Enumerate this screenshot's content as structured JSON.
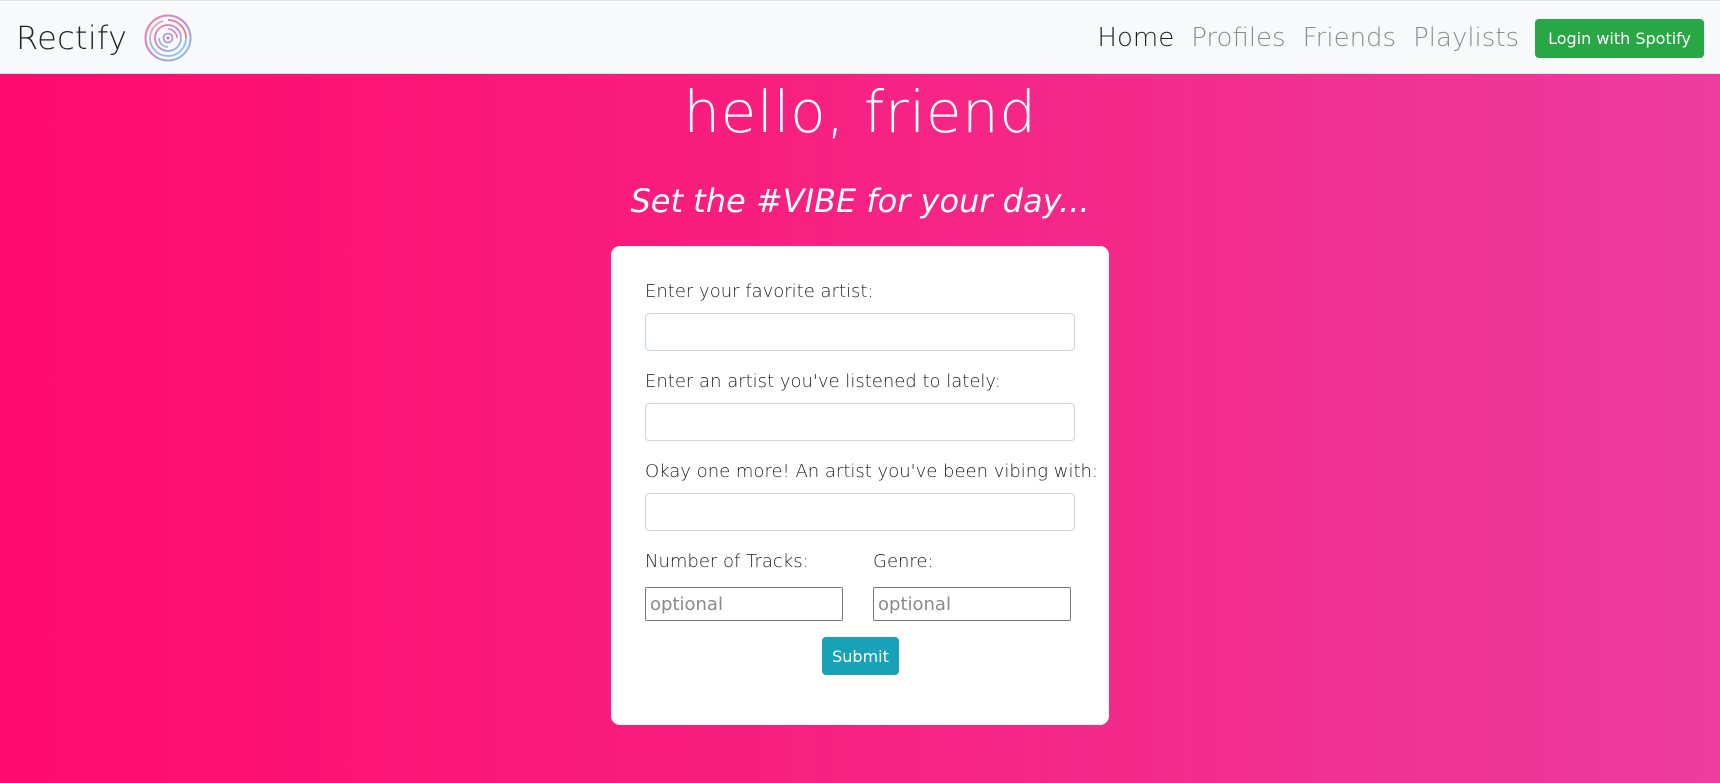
{
  "navbar": {
    "brand": "Rectify",
    "logo_icon": "vinyl-record-icon",
    "links": [
      {
        "label": "Home",
        "active": true
      },
      {
        "label": "Profiles",
        "active": false
      },
      {
        "label": "Friends",
        "active": false
      },
      {
        "label": "Playlists",
        "active": false
      }
    ],
    "login_label": "Login with Spotify"
  },
  "hero": {
    "title": "hello, friend",
    "subtitle": "Set the #VIBE for your day..."
  },
  "form": {
    "favorite_artist": {
      "label": "Enter your favorite artist:",
      "value": ""
    },
    "recent_artist": {
      "label": "Enter an artist you've listened to lately:",
      "value": ""
    },
    "vibing_artist": {
      "label": "Okay one more! An artist you've been vibing with:",
      "value": ""
    },
    "num_tracks": {
      "label": "Number of Tracks:",
      "placeholder": "optional",
      "value": ""
    },
    "genre": {
      "label": "Genre:",
      "placeholder": "optional",
      "value": ""
    },
    "submit_label": "Submit"
  },
  "colors": {
    "hero_gradient_start": "#ff0a6f",
    "hero_gradient_end": "#ec3c9d",
    "login_button": "#28a745",
    "submit_button": "#17a2b8",
    "navbar_bg": "#f8f9fa"
  }
}
